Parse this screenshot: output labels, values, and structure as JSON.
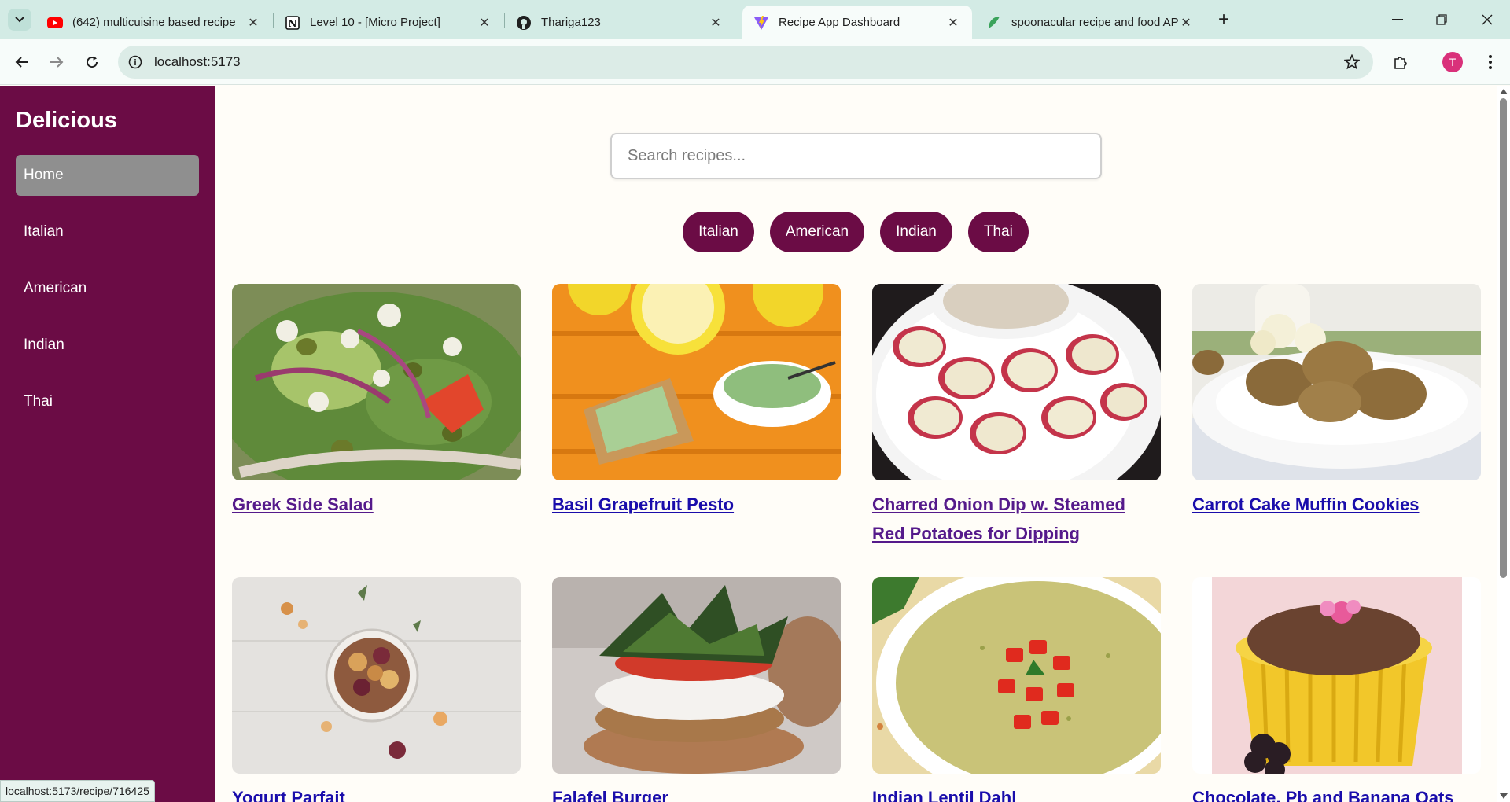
{
  "browser": {
    "tabs": [
      {
        "title": "(642) multicuisine based recipe",
        "icon": "youtube-icon",
        "active": false
      },
      {
        "title": "Level 10 - [Micro Project]",
        "icon": "notion-icon",
        "active": false
      },
      {
        "title": "Thariga123",
        "icon": "github-icon",
        "active": false
      },
      {
        "title": "Recipe App Dashboard",
        "icon": "vite-icon",
        "active": true
      },
      {
        "title": "spoonacular recipe and food AP",
        "icon": "spoonacular-icon",
        "active": false
      }
    ],
    "url": "localhost:5173",
    "profile_initial": "T",
    "status_url": "localhost:5173/recipe/716425"
  },
  "sidebar": {
    "brand": "Delicious",
    "items": [
      {
        "label": "Home",
        "active": true
      },
      {
        "label": "Italian",
        "active": false
      },
      {
        "label": "American",
        "active": false
      },
      {
        "label": "Indian",
        "active": false
      },
      {
        "label": "Thai",
        "active": false
      }
    ]
  },
  "search": {
    "placeholder": "Search recipes..."
  },
  "filters": [
    "Italian",
    "American",
    "Indian",
    "Thai"
  ],
  "recipes": [
    {
      "name": "Greek Side Salad",
      "visited": true
    },
    {
      "name": "Basil Grapefruit Pesto",
      "visited": false
    },
    {
      "name": "Charred Onion Dip w. Steamed Red Potatoes for Dipping",
      "visited": true
    },
    {
      "name": "Carrot Cake Muffin Cookies",
      "visited": false
    },
    {
      "name": "Yogurt Parfait",
      "visited": false
    },
    {
      "name": "Falafel Burger",
      "visited": false
    },
    {
      "name": "Indian Lentil Dahl",
      "visited": false
    },
    {
      "name": "Chocolate, Pb and Banana Oats",
      "visited": false
    }
  ],
  "colors": {
    "brand": "#6b0c45",
    "nav_active": "#8f8f8f",
    "link": "#1a0dab",
    "visited_link": "#551a8b"
  }
}
